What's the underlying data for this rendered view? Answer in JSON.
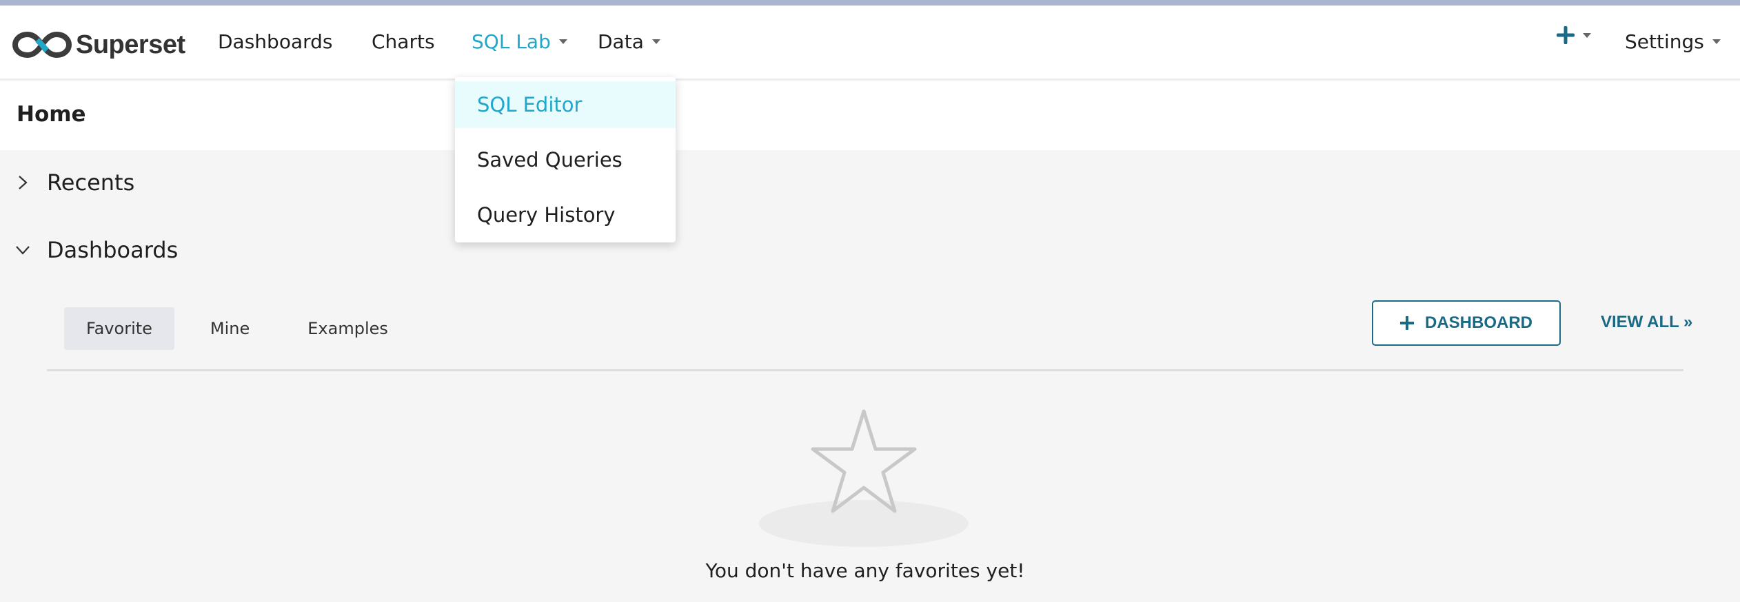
{
  "brand": {
    "name": "Superset"
  },
  "nav": {
    "dashboards": "Dashboards",
    "charts": "Charts",
    "sql_lab": "SQL Lab",
    "data": "Data",
    "settings": "Settings"
  },
  "sql_lab_menu": {
    "items": [
      "SQL Editor",
      "Saved Queries",
      "Query History"
    ]
  },
  "page": {
    "title": "Home"
  },
  "sections": {
    "recents": "Recents",
    "dashboards": "Dashboards"
  },
  "dashboard_tabs": [
    "Favorite",
    "Mine",
    "Examples"
  ],
  "actions": {
    "add_dashboard": "DASHBOARD",
    "view_all": "VIEW ALL »"
  },
  "empty_state": {
    "message": "You don't have any favorites yet!"
  },
  "colors": {
    "accent": "#20a7c9",
    "primary_dark": "#1a6a85",
    "highlight_bg": "#e8fbfd"
  }
}
